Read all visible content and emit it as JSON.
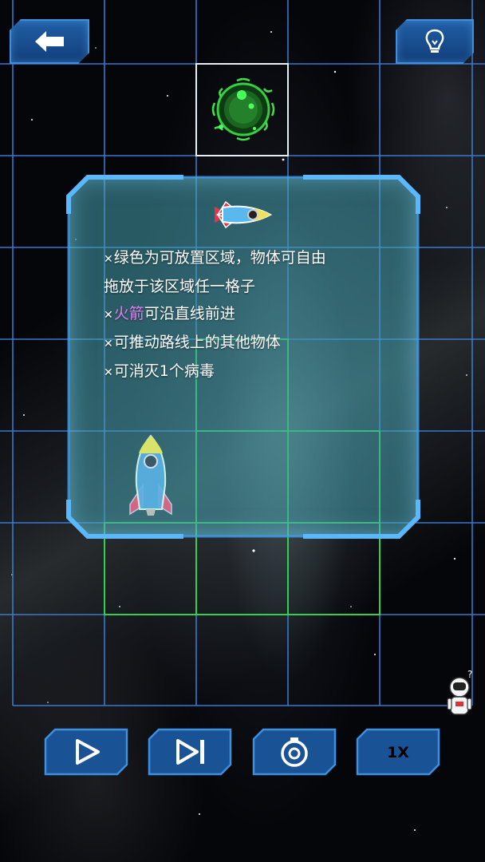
{
  "game": {
    "panel_text": {
      "line1": "绿色为可放置区域，物体可自由",
      "line2": "拖放于该区域任一格子",
      "line3_highlight": "火箭",
      "line3_rest": "可沿直线前进",
      "line4": "可推动路线上的其他物体",
      "line5": "可消灭1个病毒",
      "bullet": "✕"
    },
    "controls": {
      "speed_label": "1X"
    },
    "colors": {
      "grid_blue": "#3a7fd9",
      "grid_white": "#e8eef5",
      "grid_green": "#2fd34a",
      "highlight": "#e27ef0",
      "button_fill": "#1a5296",
      "virus_green": "#2fbf3a"
    },
    "icons": {
      "back": "arrow-left-icon",
      "hint": "lightbulb-icon",
      "play": "play-icon",
      "step": "step-forward-icon",
      "reset": "reset-timer-icon",
      "virus": "virus-icon",
      "rocket": "rocket-icon",
      "astronaut": "astronaut-icon"
    }
  }
}
